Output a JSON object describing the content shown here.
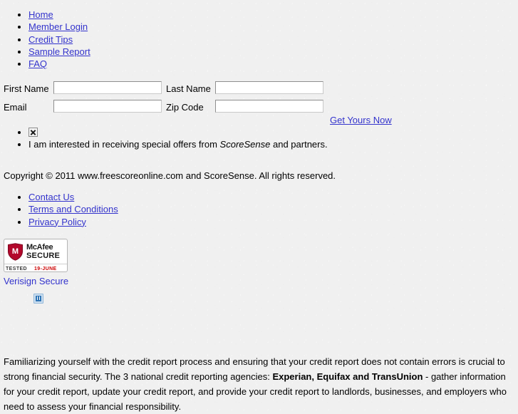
{
  "top_nav": {
    "items": [
      {
        "label": "Home"
      },
      {
        "label": "Member Login"
      },
      {
        "label": "Credit Tips"
      },
      {
        "label": "Sample Report"
      },
      {
        "label": "FAQ"
      }
    ]
  },
  "form": {
    "first_name": {
      "label": "First Name",
      "value": "",
      "placeholder": ""
    },
    "last_name": {
      "label": "Last Name",
      "value": "",
      "placeholder": ""
    },
    "email": {
      "label": "Email",
      "value": "",
      "placeholder": ""
    },
    "zip_code": {
      "label": "Zip Code",
      "value": "",
      "placeholder": ""
    },
    "submit_link": "Get Yours Now"
  },
  "offers": {
    "checkbox_icon": "broken-image-icon",
    "text_before": "I am interested in receiving special offers from ",
    "brand": "ScoreSense",
    "text_after": " and partners."
  },
  "copyright": "Copyright © 2011 www.freescoreonline.com and ScoreSense. All rights reserved.",
  "footer_nav": {
    "items": [
      {
        "label": "Contact Us"
      },
      {
        "label": "Terms and Conditions"
      },
      {
        "label": "Privacy Policy"
      }
    ]
  },
  "badges": {
    "mcafee": {
      "brand": "McAfee",
      "secure": "SECURE",
      "tested_label": "TESTED",
      "tested_date": "19-JUNE",
      "shield_letter": "M",
      "shield_color": "#b3092c"
    },
    "verisign_label": "Verisign Secure",
    "placeholder_icon": "broken-image-icon"
  },
  "info_paragraph": {
    "part1": "Familiarizing yourself with the credit report process and ensuring that your credit report does not contain errors is crucial to strong financial security. The 3 national credit reporting agencies: ",
    "agencies": "Experian, Equifax and TransUnion",
    "part2": " - gather information for your credit report, update your credit report, and provide your credit report to landlords, businesses, and employers who need to assess your financial responsibility."
  },
  "colors": {
    "link": "#3333cc",
    "page_background": "#f0f0f0",
    "mcafee_red": "#b3092c",
    "tested_date_red": "#cc0000"
  }
}
